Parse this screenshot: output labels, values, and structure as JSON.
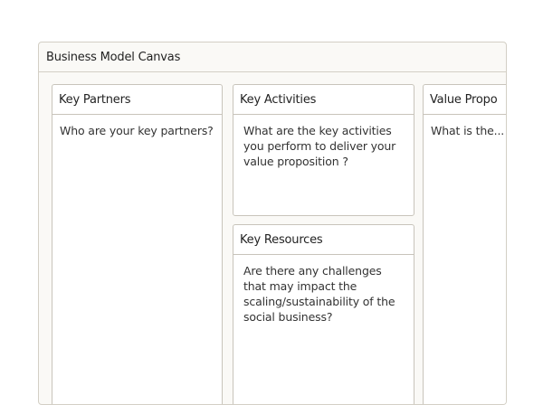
{
  "panel": {
    "title": "Business Model Canvas"
  },
  "cards": {
    "key_partners": {
      "title": "Key Partners",
      "prompt": "Who are your key partners?"
    },
    "key_activities": {
      "title": "Key Activities",
      "prompt": "What are the key activities you perform to deliver your value proposition ?"
    },
    "key_resources": {
      "title": "Key Resources",
      "prompt": "Are there any challenges that may impact the scaling/sustainability of the social business?"
    },
    "value_propositions": {
      "title": "Value Propo",
      "prompt": "What is the..."
    }
  }
}
